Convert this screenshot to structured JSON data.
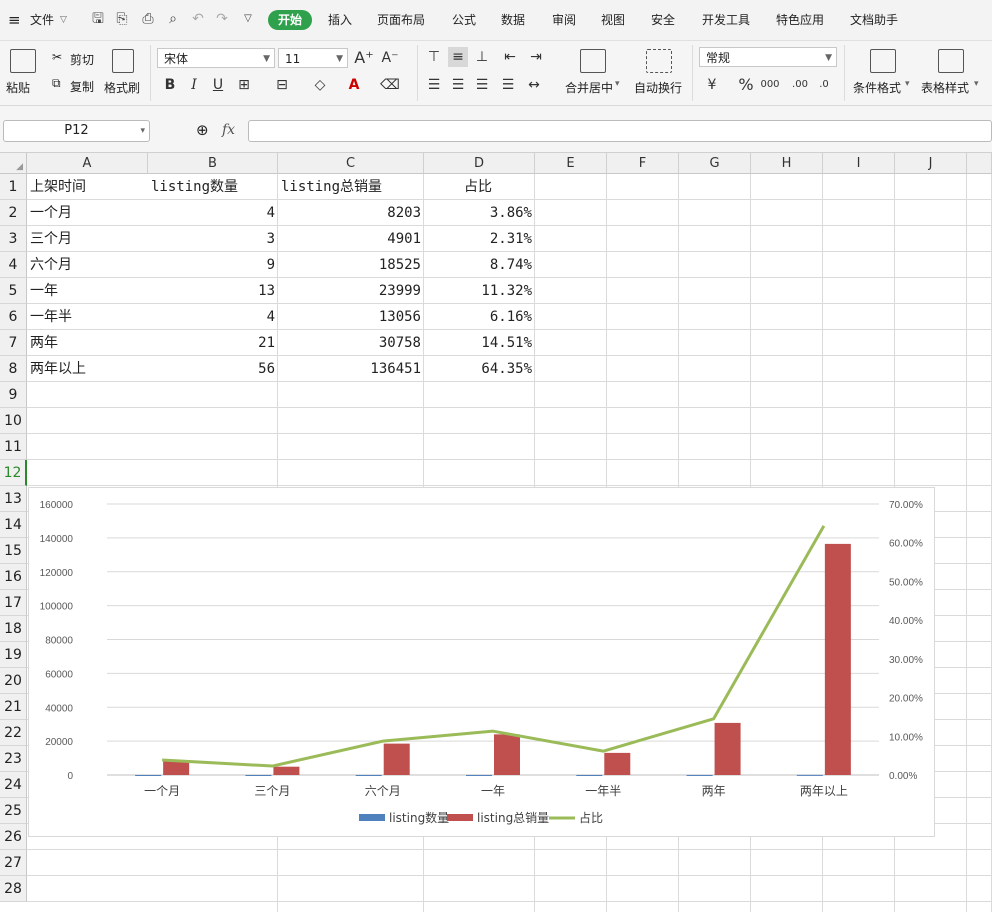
{
  "menu": {
    "file": "文件",
    "tabs": [
      "开始",
      "插入",
      "页面布局",
      "公式",
      "数据",
      "审阅",
      "视图",
      "安全",
      "开发工具",
      "特色应用",
      "文档助手"
    ],
    "active_tab": "开始"
  },
  "ribbon": {
    "paste": "粘贴",
    "cut": "剪切",
    "copy": "复制",
    "format_painter": "格式刷",
    "font_name": "宋体",
    "font_size": "11",
    "merge_center": "合并居中",
    "wrap_text": "自动换行",
    "number_format": "常规",
    "conditional_format": "条件格式",
    "table_style": "表格样式"
  },
  "formula_bar": {
    "name_box": "P12",
    "fx": "fx",
    "value": ""
  },
  "columns": [
    "A",
    "B",
    "C",
    "D",
    "E",
    "F",
    "G",
    "H",
    "I",
    "J"
  ],
  "rows": [
    "1",
    "2",
    "3",
    "4",
    "5",
    "6",
    "7",
    "8",
    "9",
    "10",
    "11",
    "12",
    "13",
    "14",
    "15",
    "16",
    "17",
    "18",
    "19",
    "20",
    "21",
    "22",
    "23",
    "24",
    "25",
    "26",
    "27",
    "28"
  ],
  "table": {
    "header": [
      "上架时间",
      "listing数量",
      "listing总销量",
      "占比"
    ],
    "body": [
      [
        "一个月",
        "4",
        "8203",
        "3.86%"
      ],
      [
        "三个月",
        "3",
        "4901",
        "2.31%"
      ],
      [
        "六个月",
        "9",
        "18525",
        "8.74%"
      ],
      [
        "一年",
        "13",
        "23999",
        "11.32%"
      ],
      [
        "一年半",
        "4",
        "13056",
        "6.16%"
      ],
      [
        "两年",
        "21",
        "30758",
        "14.51%"
      ],
      [
        "两年以上",
        "56",
        "136451",
        "64.35%"
      ]
    ]
  },
  "colors": {
    "series_count": "#4f81bd",
    "series_sales": "#c0504d",
    "series_ratio": "#9bbb59",
    "active_tab": "#2fa04c"
  },
  "chart_data": {
    "type": "bar",
    "categories": [
      "一个月",
      "三个月",
      "六个月",
      "一年",
      "一年半",
      "两年",
      "两年以上"
    ],
    "series": [
      {
        "name": "listing数量",
        "type": "bar",
        "axis": "left",
        "values": [
          4,
          3,
          9,
          13,
          4,
          21,
          56
        ]
      },
      {
        "name": "listing总销量",
        "type": "bar",
        "axis": "left",
        "values": [
          8203,
          4901,
          18525,
          23999,
          13056,
          30758,
          136451
        ]
      },
      {
        "name": "占比",
        "type": "line",
        "axis": "right",
        "values": [
          3.86,
          2.31,
          8.74,
          11.32,
          6.16,
          14.51,
          64.35
        ]
      }
    ],
    "y_left": {
      "min": 0,
      "max": 160000,
      "ticks": [
        "0",
        "20000",
        "40000",
        "60000",
        "80000",
        "100000",
        "120000",
        "140000",
        "160000"
      ]
    },
    "y_right": {
      "min": 0,
      "max": 70,
      "ticks": [
        "0.00%",
        "10.00%",
        "20.00%",
        "30.00%",
        "40.00%",
        "50.00%",
        "60.00%",
        "70.00%"
      ]
    },
    "grid": true,
    "legend": "bottom"
  }
}
